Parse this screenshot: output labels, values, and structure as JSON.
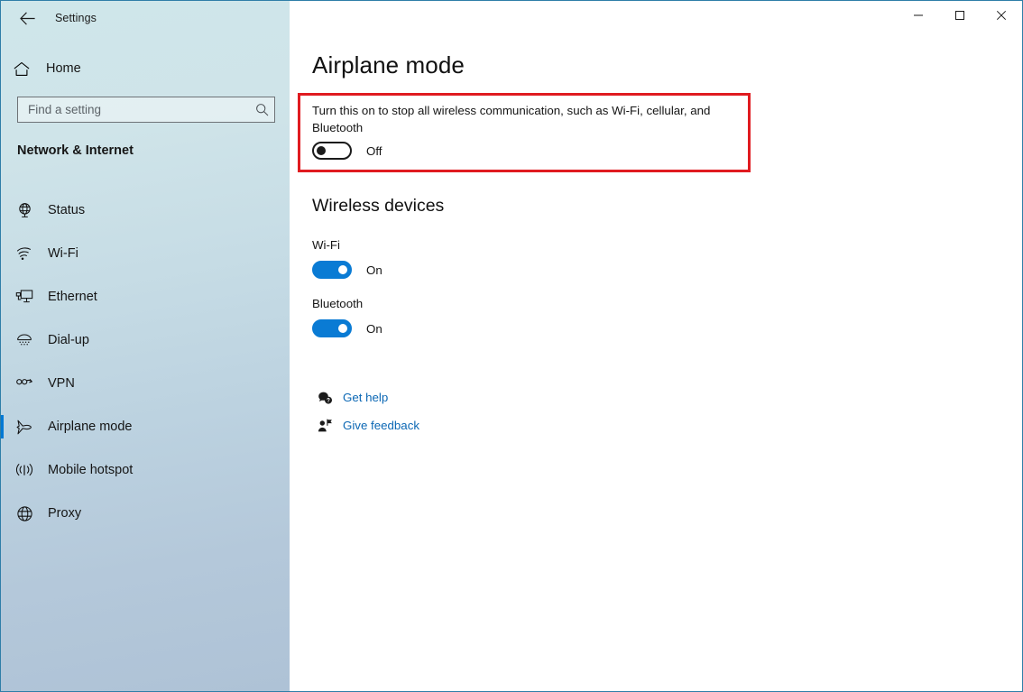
{
  "window": {
    "title": "Settings",
    "back_label": "Back",
    "controls": {
      "minimize": "Minimize",
      "maximize": "Maximize",
      "close": "Close"
    }
  },
  "sidebar": {
    "home": {
      "label": "Home",
      "icon": "home-icon"
    },
    "search": {
      "placeholder": "Find a setting",
      "value": "",
      "icon": "search-icon"
    },
    "category": "Network & Internet",
    "items": [
      {
        "label": "Status",
        "icon": "globe-monitor-icon",
        "selected": false
      },
      {
        "label": "Wi-Fi",
        "icon": "wifi-icon",
        "selected": false
      },
      {
        "label": "Ethernet",
        "icon": "ethernet-icon",
        "selected": false
      },
      {
        "label": "Dial-up",
        "icon": "dialup-icon",
        "selected": false
      },
      {
        "label": "VPN",
        "icon": "vpn-icon",
        "selected": false
      },
      {
        "label": "Airplane mode",
        "icon": "airplane-icon",
        "selected": true
      },
      {
        "label": "Mobile hotspot",
        "icon": "hotspot-icon",
        "selected": false
      },
      {
        "label": "Proxy",
        "icon": "proxy-globe-icon",
        "selected": false
      }
    ]
  },
  "main": {
    "page_title": "Airplane mode",
    "description": "Turn this on to stop all wireless communication, such as Wi-Fi, cellular, and Bluetooth",
    "airplane_toggle": {
      "state": "Off",
      "on": false
    },
    "wireless_heading": "Wireless devices",
    "devices": [
      {
        "label": "Wi-Fi",
        "state": "On",
        "on": true
      },
      {
        "label": "Bluetooth",
        "state": "On",
        "on": true
      }
    ],
    "links": [
      {
        "label": "Get help",
        "icon": "help-bubble-icon"
      },
      {
        "label": "Give feedback",
        "icon": "feedback-person-icon"
      }
    ]
  },
  "annotation": {
    "highlight_color": "#e01b20",
    "target": "airplane-mode-toggle-section"
  },
  "colors": {
    "accent": "#0078d4",
    "toggle_on": "#0a7bd4",
    "link": "#0b67b4",
    "window_border": "#2f7ea8",
    "highlight": "#e01b20"
  }
}
